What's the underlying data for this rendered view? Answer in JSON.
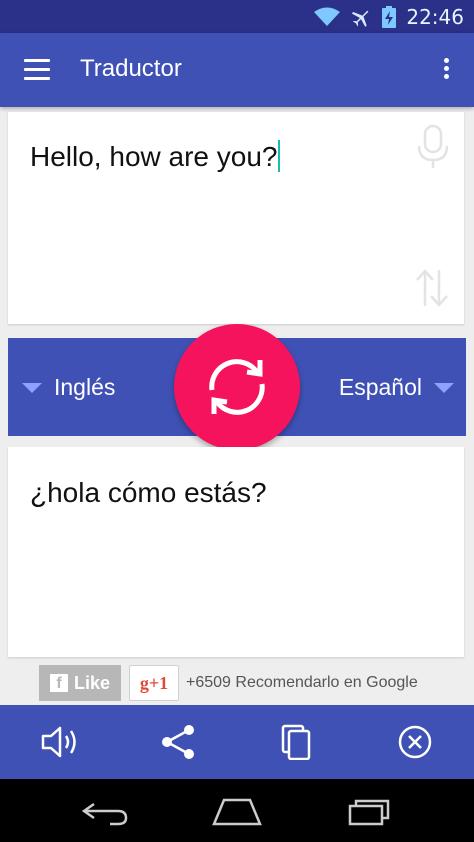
{
  "status_bar": {
    "time": "22:46"
  },
  "app_bar": {
    "title": "Traductor"
  },
  "input": {
    "text": "Hello, how are you?"
  },
  "languages": {
    "source": "Inglés",
    "target": "Español"
  },
  "output": {
    "text": "¿hola cómo estás?"
  },
  "social": {
    "facebook_label": "Like",
    "facebook_logo": "f",
    "gplus_label": "g+1",
    "gplus_count_text": "+6509 Recomendarlo en Google"
  },
  "colors": {
    "primary": "#3f51b5",
    "primary_dark": "#2b3088",
    "accent": "#f5135e",
    "caret": "#1dbbae"
  },
  "toolbar": {
    "icons": [
      "speaker-icon",
      "share-icon",
      "copy-icon",
      "clear-icon"
    ]
  }
}
